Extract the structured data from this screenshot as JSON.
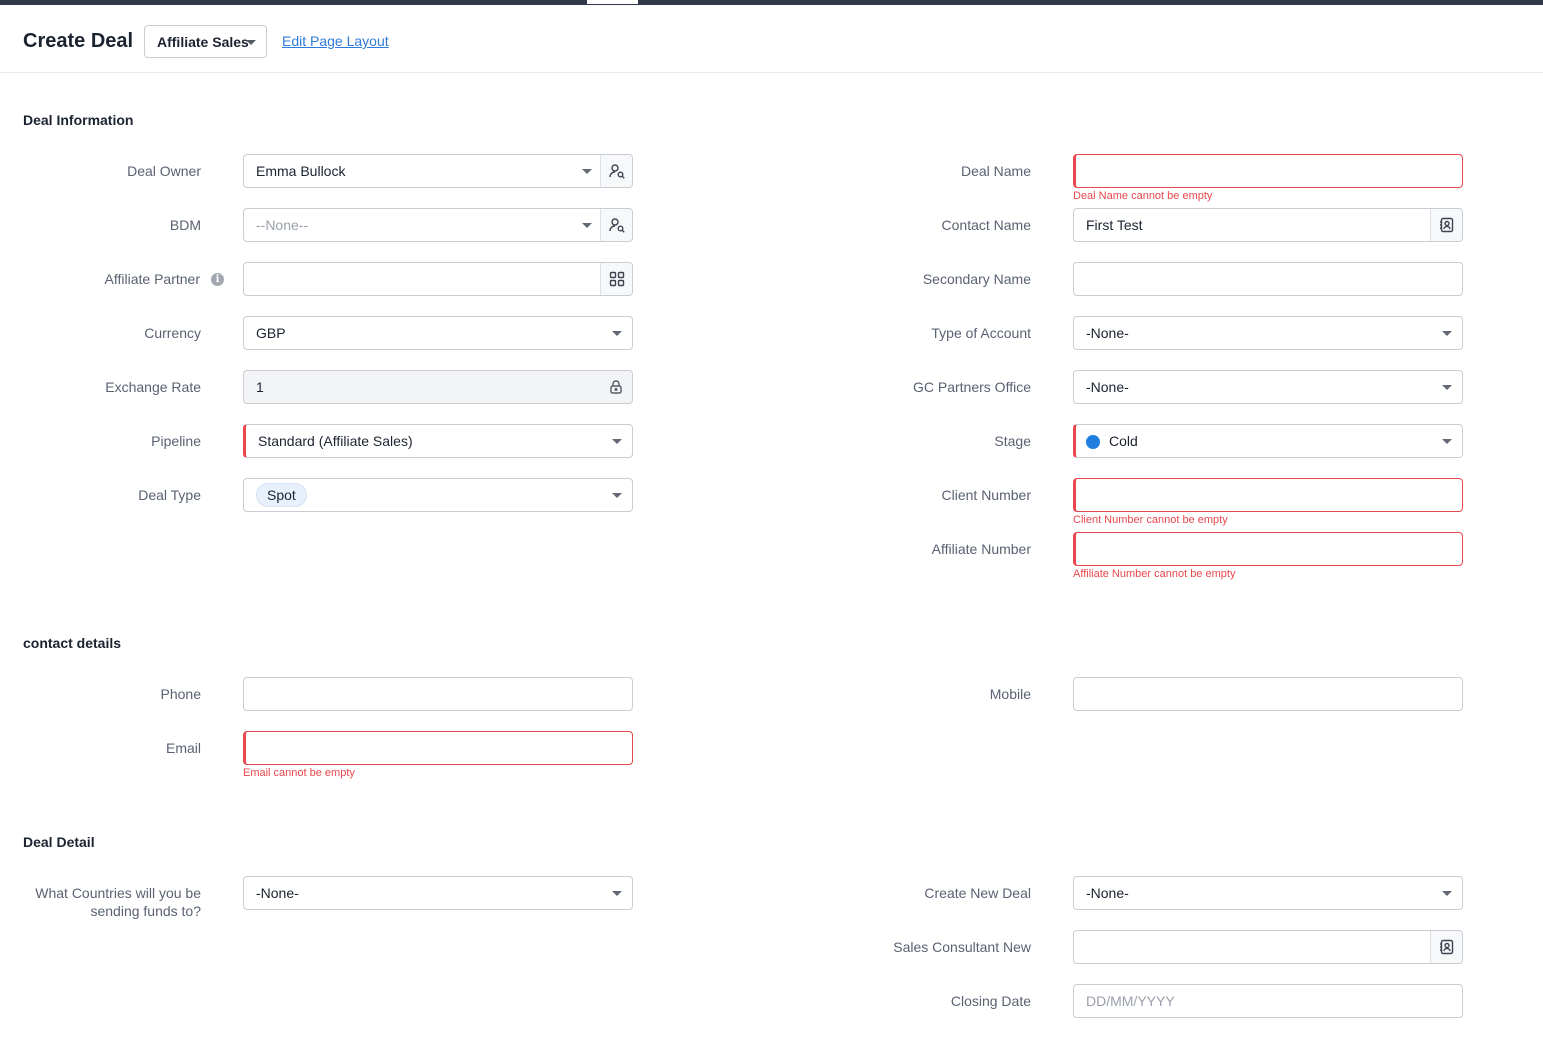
{
  "header": {
    "title": "Create Deal",
    "layout_selected": "Affiliate Sales",
    "edit_layout_link": "Edit Page Layout"
  },
  "sections": {
    "deal_information": "Deal Information",
    "contact_details": "contact details",
    "deal_detail": "Deal Detail"
  },
  "deal_information": {
    "deal_owner": {
      "label": "Deal Owner",
      "value": "Emma Bullock"
    },
    "bdm": {
      "label": "BDM",
      "placeholder": "--None--"
    },
    "affiliate_partner": {
      "label": "Affiliate Partner",
      "info_glyph": "i"
    },
    "currency": {
      "label": "Currency",
      "value": "GBP"
    },
    "exchange_rate": {
      "label": "Exchange Rate",
      "value": "1"
    },
    "pipeline": {
      "label": "Pipeline",
      "value": "Standard (Affiliate Sales)"
    },
    "deal_type": {
      "label": "Deal Type",
      "value": "Spot"
    },
    "deal_name": {
      "label": "Deal Name",
      "error": "Deal Name cannot be empty"
    },
    "contact_name": {
      "label": "Contact Name",
      "value": "First Test"
    },
    "secondary_name": {
      "label": "Secondary Name"
    },
    "type_of_account": {
      "label": "Type of Account",
      "value": "-None-"
    },
    "gc_partners_office": {
      "label": "GC Partners Office",
      "value": "-None-"
    },
    "stage": {
      "label": "Stage",
      "value": "Cold",
      "dot_color": "#1f7ee0"
    },
    "client_number": {
      "label": "Client Number",
      "error": "Client Number cannot be empty"
    },
    "affiliate_number": {
      "label": "Affiliate Number",
      "error": "Affiliate Number cannot be empty"
    }
  },
  "contact_details": {
    "phone": {
      "label": "Phone"
    },
    "mobile": {
      "label": "Mobile"
    },
    "email": {
      "label": "Email",
      "error": "Email cannot be empty"
    }
  },
  "deal_detail": {
    "countries_label_line1": "What Countries will you be",
    "countries_label_line2": "sending funds to?",
    "countries_value": "-None-",
    "create_new_deal": {
      "label": "Create New Deal",
      "value": "-None-"
    },
    "sales_consultant_new": {
      "label": "Sales Consultant New"
    },
    "closing_date": {
      "label": "Closing Date",
      "placeholder": "DD/MM/YYYY"
    }
  },
  "icons": {
    "user_lookup": "user-search-icon",
    "contact_lookup": "contact-card-icon",
    "grid_lookup": "grid-icon",
    "lock": "lock-icon",
    "info": "info-icon"
  },
  "colors": {
    "error": "#e8484d",
    "link": "#2f7bd9",
    "topbar": "#313949"
  }
}
